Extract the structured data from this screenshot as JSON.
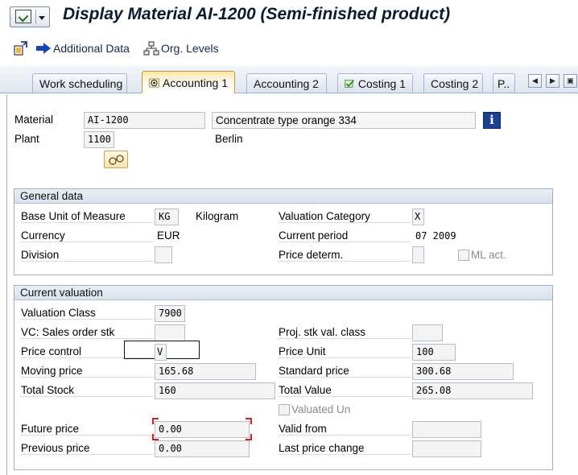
{
  "title": "Display Material AI-1200 (Semi-finished product)",
  "toolbar": {
    "additional_data": "Additional Data",
    "org_levels": "Org. Levels"
  },
  "tabs": [
    {
      "label": "Work scheduling"
    },
    {
      "label": "Accounting 1",
      "active": true
    },
    {
      "label": "Accounting 2"
    },
    {
      "label": "Costing 1"
    },
    {
      "label": "Costing 2"
    },
    {
      "label": "P.."
    }
  ],
  "header": {
    "material_label": "Material",
    "material_value": "AI-1200",
    "material_desc": "Concentrate type orange 334",
    "plant_label": "Plant",
    "plant_value": "1100",
    "plant_name": "Berlin"
  },
  "general": {
    "title": "General data",
    "base_uom_label": "Base Unit of Measure",
    "base_uom_value": "KG",
    "base_uom_text": "Kilogram",
    "valuation_category_label": "Valuation Category",
    "valuation_category_value": "X",
    "currency_label": "Currency",
    "currency_value": "EUR",
    "current_period_label": "Current period",
    "current_period_value": "07 2009",
    "division_label": "Division",
    "division_value": "",
    "price_determ_label": "Price determ.",
    "price_determ_value": "",
    "ml_act_label": "ML act."
  },
  "valuation": {
    "title": "Current valuation",
    "valuation_class_label": "Valuation Class",
    "valuation_class_value": "7900",
    "vc_sales_label": "VC: Sales order stk",
    "vc_sales_value": "",
    "proj_stk_label": "Proj. stk val. class",
    "proj_stk_value": "",
    "price_control_label": "Price control",
    "price_control_value": "V",
    "price_unit_label": "Price Unit",
    "price_unit_value": "100",
    "moving_price_label": "Moving price",
    "moving_price_value": "165.68",
    "standard_price_label": "Standard price",
    "standard_price_value": "300.68",
    "total_stock_label": "Total Stock",
    "total_stock_value": "160",
    "total_value_label": "Total Value",
    "total_value_value": "265.08",
    "valuated_un_label": "Valuated Un",
    "future_price_label": "Future price",
    "future_price_value": "0.00",
    "valid_from_label": "Valid from",
    "valid_from_value": "",
    "previous_price_label": "Previous price",
    "previous_price_value": "0.00",
    "last_price_change_label": "Last price change",
    "last_price_change_value": ""
  },
  "colors": {
    "title": "#0e1b2f",
    "accent_blue": "#1b3f92",
    "active_tab": "#ffe9a8",
    "highlight_red": "#cc2222"
  }
}
